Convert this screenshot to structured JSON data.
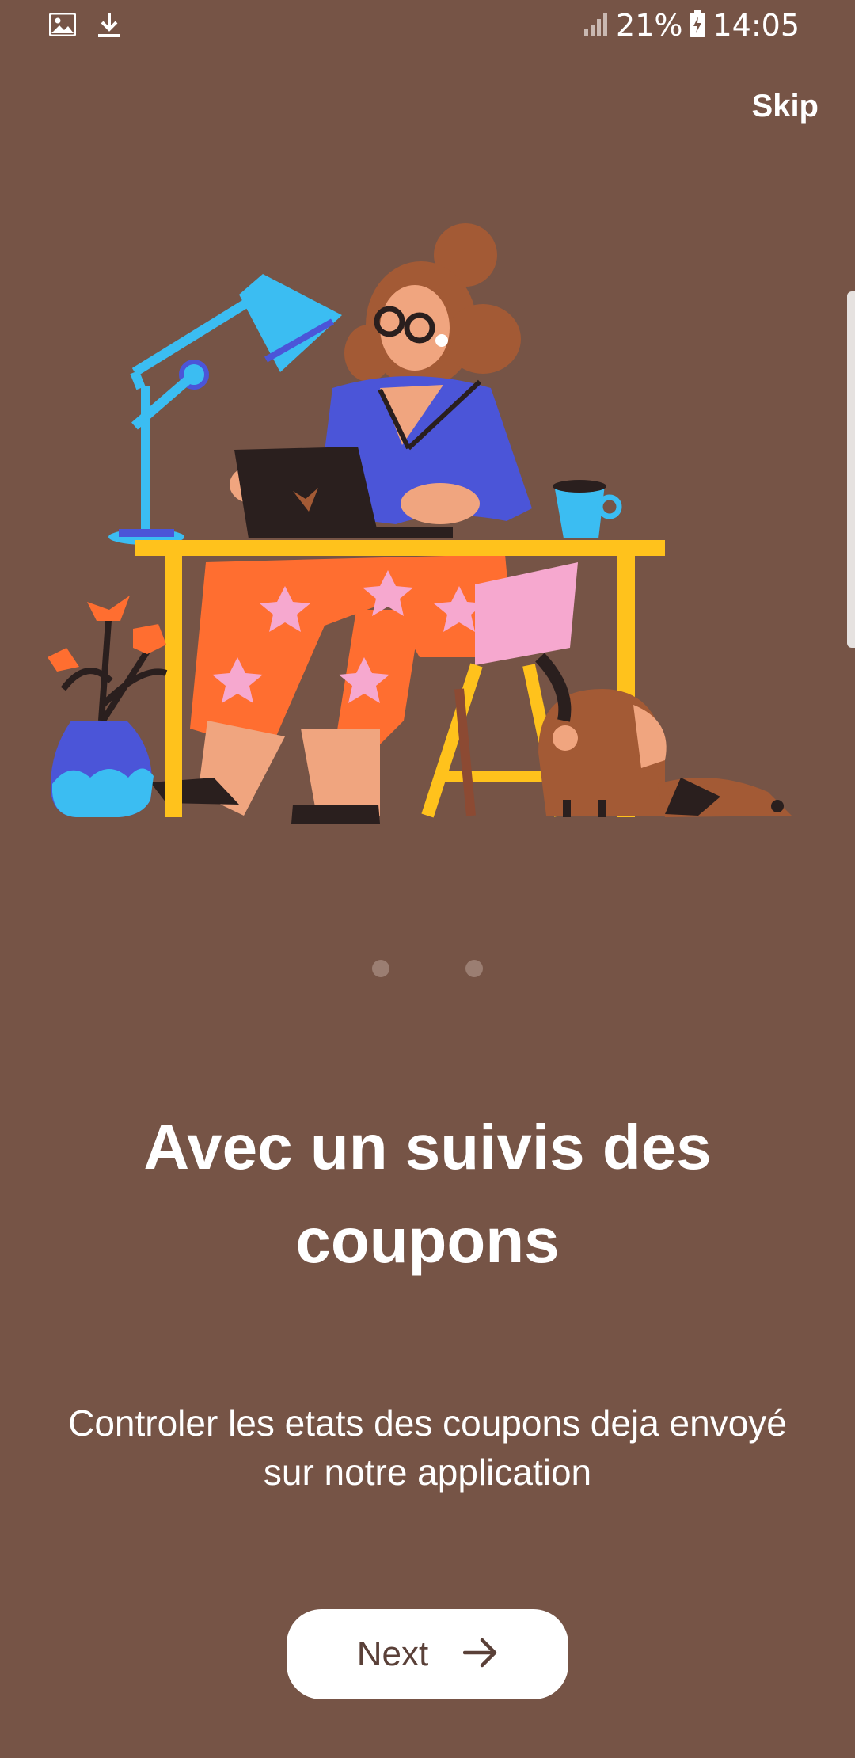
{
  "status_bar": {
    "battery": "21%",
    "time": "14:05"
  },
  "skip_label": "Skip",
  "pager": {
    "count": 2,
    "active": 0
  },
  "title": "Avec un suivis des coupons",
  "subtitle": "Controler les etats des coupons deja envoyé sur notre application",
  "next_label": "Next",
  "icons": [
    "image-icon",
    "download-icon",
    "signal-icon",
    "battery-icon",
    "arrow-right-icon"
  ],
  "colors": {
    "background": "#765446",
    "button": "#ffffff",
    "button_text": "#5a4038"
  }
}
